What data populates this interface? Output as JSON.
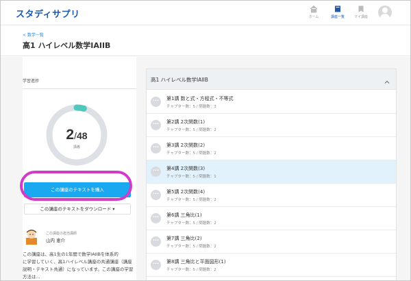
{
  "app": {
    "logo": "スタディサプリ"
  },
  "header": {
    "nav": [
      {
        "label": "ホーム",
        "icon": "home-icon"
      },
      {
        "label": "講座一覧",
        "icon": "book-icon"
      },
      {
        "label": "マイ講座",
        "icon": "bookmark-icon"
      }
    ]
  },
  "page": {
    "breadcrumb": "< 数学一覧",
    "title": "高1 ハイレベル数学IAIIB"
  },
  "progress": {
    "heading": "学習進捗",
    "done": "2",
    "total": "48",
    "unit": "講義",
    "fraction": 0.0417
  },
  "buttons": {
    "buy": "この講座のテキストを購入",
    "download": "この講座のテキストをダウンロード ▾"
  },
  "teacher": {
    "label": "この講座の担当講師",
    "name": "山内 恵介",
    "desc_lines": [
      "この講座は、高1生の1年間で数学IAIIBを体系的",
      "に学習していく、高1ハイレベル講座の共通講座（講座",
      "説明・テキスト共通）になっています。この講座の学習",
      "方法は..."
    ]
  },
  "course_list": {
    "header": "高1 ハイレベル数学IAIIB",
    "chapters": [
      {
        "title": "第1講 数と式・方程式・不等式",
        "sub": "チャプター数：5 / 問題数：3"
      },
      {
        "title": "第2講 2次関数(1)",
        "sub": "チャプター数：5 / 問題数：2"
      },
      {
        "title": "第3講 2次関数(2)",
        "sub": "チャプター数：5 / 問題数：2"
      },
      {
        "title": "第4講 2次関数(3)",
        "sub": "チャプター数：5 / 問題数：1"
      },
      {
        "title": "第5講 2次関数(4)",
        "sub": "チャプター数：5 / 問題数：2"
      },
      {
        "title": "第6講 三角比(1)",
        "sub": "チャプター数：5 / 問題数：2"
      },
      {
        "title": "第7講 三角比(2)",
        "sub": "チャプター数：5 / 問題数：2"
      },
      {
        "title": "第8講 三角比と平面図形(1)",
        "sub": "チャプター数：5 / 問題数：2"
      }
    ],
    "selected_index": 3
  },
  "colors": {
    "accent": "#1aa9f0",
    "donut_done": "#4fc9bd",
    "donut_track": "#dde1e6",
    "highlight": "#d13bc8",
    "selected_row": "#e1f2fc"
  }
}
